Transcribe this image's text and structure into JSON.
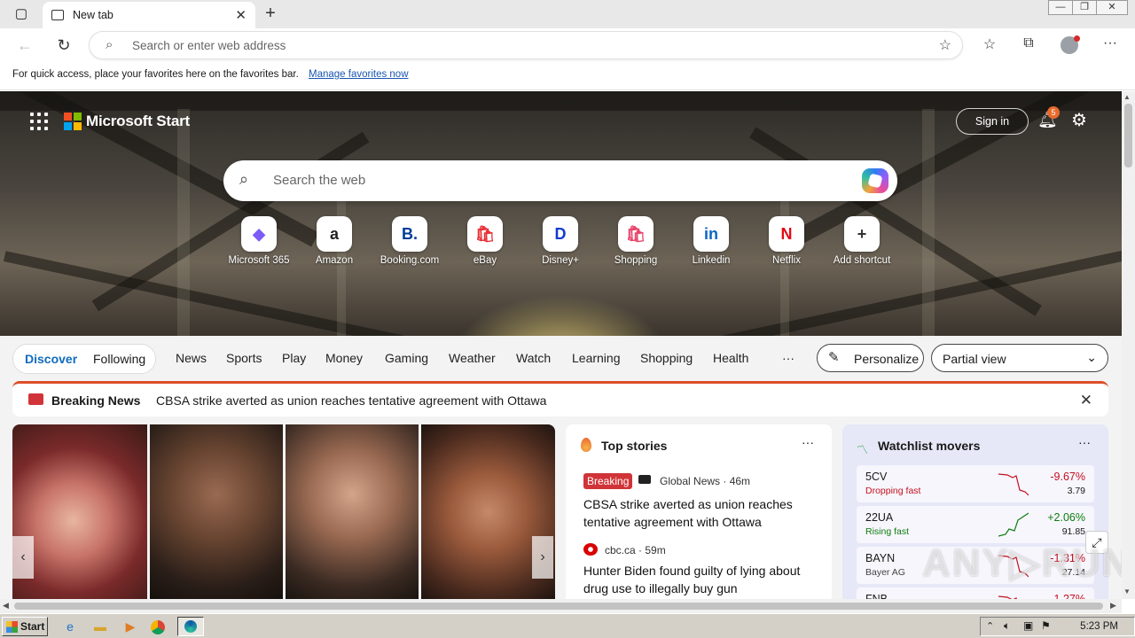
{
  "tab": {
    "title": "New tab"
  },
  "address": {
    "placeholder": "Search or enter web address"
  },
  "favorites_bar": {
    "message": "For quick access, place your favorites here on the favorites bar.",
    "link": "Manage favorites now"
  },
  "hero": {
    "brand": "Microsoft Start",
    "sign_in": "Sign in",
    "notification_count": "5",
    "search_placeholder": "Search the web",
    "shortcuts": [
      {
        "label": "Microsoft 365",
        "glyph": "◆",
        "color": "#7b5cf6"
      },
      {
        "label": "Amazon",
        "glyph": "a",
        "color": "#222222"
      },
      {
        "label": "Booking.com",
        "glyph": "B.",
        "color": "#003b95"
      },
      {
        "label": "eBay",
        "glyph": "🛍",
        "color": "#e53238"
      },
      {
        "label": "Disney+",
        "glyph": "D",
        "color": "#113ccf"
      },
      {
        "label": "Shopping",
        "glyph": "🛍",
        "color": "#e8436a"
      },
      {
        "label": "Linkedin",
        "glyph": "in",
        "color": "#0a66c2"
      },
      {
        "label": "Netflix",
        "glyph": "N",
        "color": "#e50914"
      },
      {
        "label": "Add shortcut",
        "glyph": "+",
        "color": "#333333"
      }
    ]
  },
  "feed_nav": {
    "discover": "Discover",
    "following": "Following",
    "items": [
      "News",
      "Sports",
      "Play",
      "Money",
      "Gaming",
      "Weather",
      "Watch",
      "Learning",
      "Shopping",
      "Health"
    ],
    "more": "···",
    "personalize": "Personalize",
    "view": "Partial view"
  },
  "breaking": {
    "label": "Breaking News",
    "headline": "CBSA strike averted as union reaches tentative agreement with Ottawa"
  },
  "top_stories": {
    "title": "Top stories",
    "stories": [
      {
        "badge": "Breaking",
        "source": "Global News · 46m",
        "headline": "CBSA strike averted as union reaches tentative agreement with Ottawa"
      },
      {
        "source": "cbc.ca · 59m",
        "headline": "Hunter Biden found guilty of lying about drug use to illegally buy gun"
      }
    ]
  },
  "watchlist": {
    "title": "Watchlist movers",
    "stocks": [
      {
        "ticker": "5CV",
        "sub": "Dropping fast",
        "pct": "-9.67%",
        "price": "3.79",
        "color": "#c50f1f"
      },
      {
        "ticker": "22UA",
        "sub": "Rising fast",
        "pct": "+2.06%",
        "price": "91.85",
        "color": "#107c10"
      },
      {
        "ticker": "BAYN",
        "sub": "Bayer AG",
        "pct": "-1.31%",
        "price": "27.14",
        "color": "#c50f1f"
      },
      {
        "ticker": "FNB",
        "sub": "",
        "pct": "-1.27%",
        "price": "",
        "color": "#c50f1f"
      }
    ]
  },
  "watermark": "ANY RUN",
  "taskbar": {
    "start": "Start",
    "clock": "5:23 PM"
  }
}
